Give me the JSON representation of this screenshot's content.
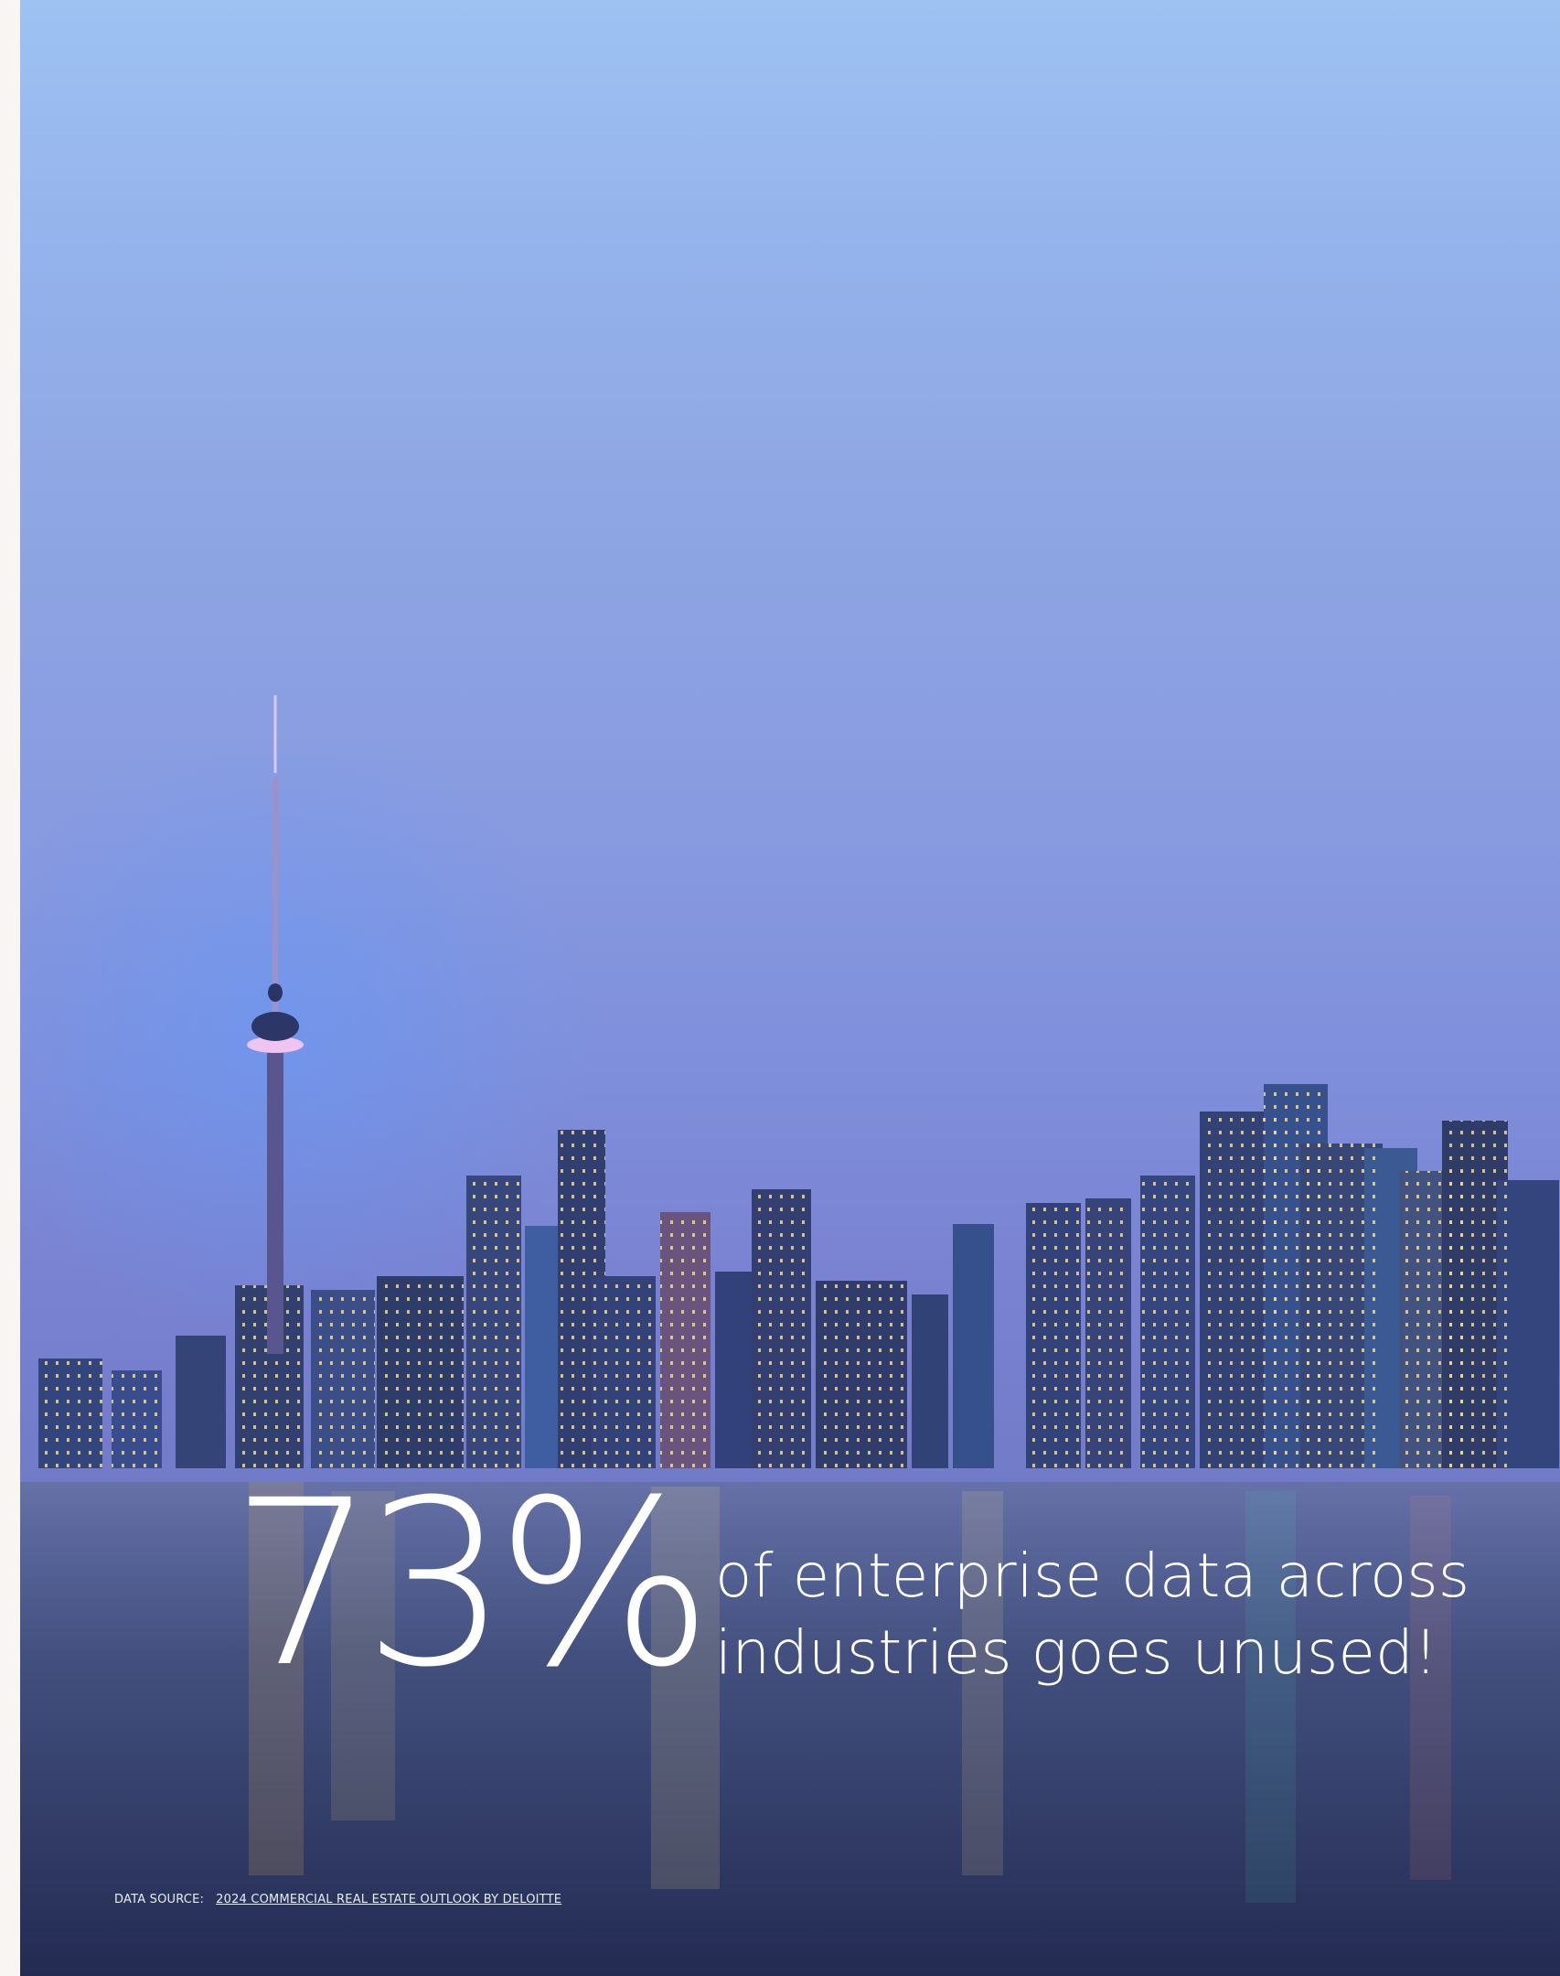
{
  "headline": {
    "big_number": "73%",
    "line1": "of enterprise data across",
    "line2": "industries goes unused!"
  },
  "source": {
    "label": "DATA SOURCE:",
    "link_text": "2024 COMMERCIAL REAL ESTATE OUTLOOK BY DELOITTE"
  },
  "colors": {
    "sky_top": "#9ec2f2",
    "sky_mid": "#7f8fdb",
    "water": "#262e58",
    "text": "#ffffff"
  }
}
